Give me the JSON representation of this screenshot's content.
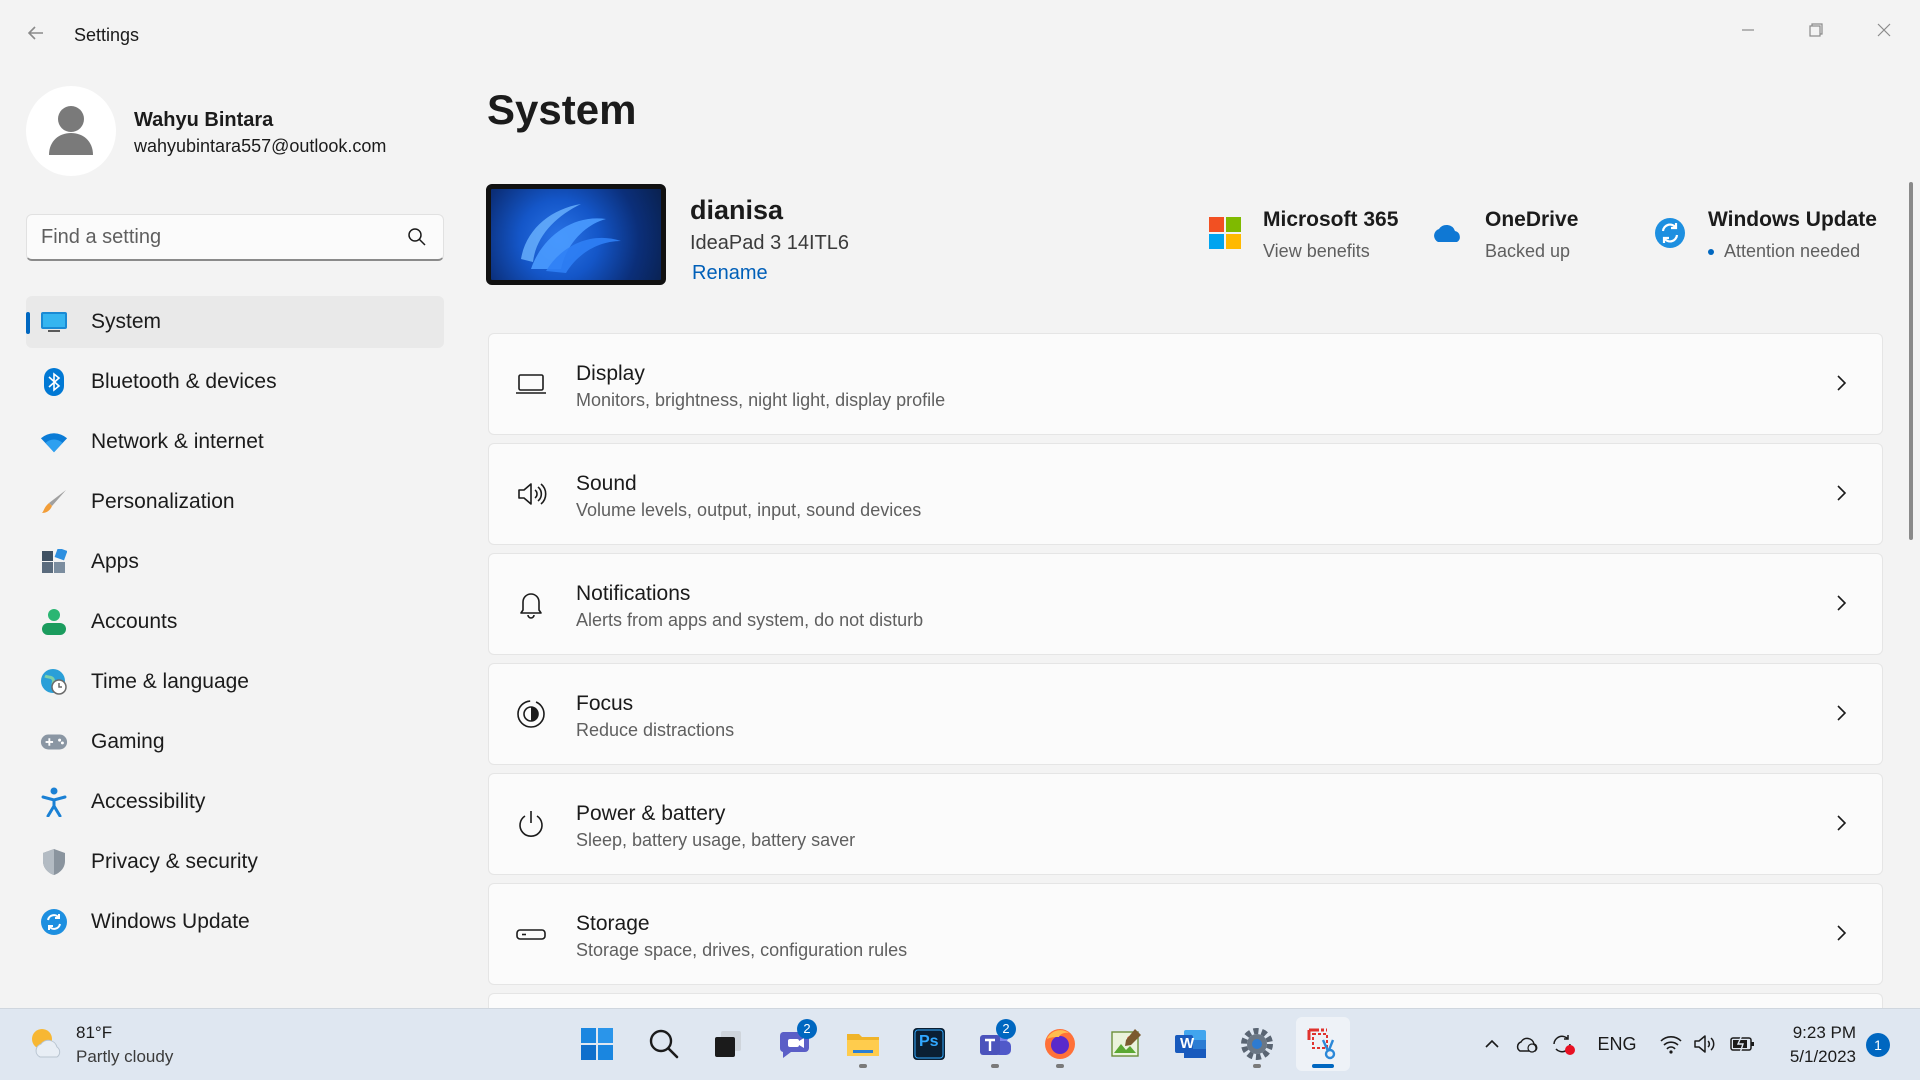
{
  "window": {
    "title": "Settings"
  },
  "profile": {
    "name": "Wahyu Bintara",
    "email": "wahyubintara557@outlook.com"
  },
  "search": {
    "placeholder": "Find a setting"
  },
  "nav": {
    "items": [
      {
        "label": "System",
        "icon": "system-icon",
        "active": true
      },
      {
        "label": "Bluetooth & devices",
        "icon": "bluetooth-icon"
      },
      {
        "label": "Network & internet",
        "icon": "wifi-icon"
      },
      {
        "label": "Personalization",
        "icon": "brush-icon"
      },
      {
        "label": "Apps",
        "icon": "apps-icon"
      },
      {
        "label": "Accounts",
        "icon": "accounts-icon"
      },
      {
        "label": "Time & language",
        "icon": "globe-clock-icon"
      },
      {
        "label": "Gaming",
        "icon": "gamepad-icon"
      },
      {
        "label": "Accessibility",
        "icon": "accessibility-icon"
      },
      {
        "label": "Privacy & security",
        "icon": "shield-icon"
      },
      {
        "label": "Windows Update",
        "icon": "update-icon"
      }
    ]
  },
  "main": {
    "title": "System",
    "device": {
      "name": "dianisa",
      "model": "IdeaPad 3 14ITL6",
      "rename_label": "Rename"
    },
    "tiles": [
      {
        "title": "Microsoft 365",
        "subtitle": "View benefits",
        "icon": "microsoft365-icon"
      },
      {
        "title": "OneDrive",
        "subtitle": "Backed up",
        "icon": "onedrive-icon"
      },
      {
        "title": "Windows Update",
        "subtitle": "Attention needed",
        "icon": "update-icon"
      }
    ],
    "cards": [
      {
        "title": "Display",
        "subtitle": "Monitors, brightness, night light, display profile",
        "icon": "display-icon"
      },
      {
        "title": "Sound",
        "subtitle": "Volume levels, output, input, sound devices",
        "icon": "speaker-icon"
      },
      {
        "title": "Notifications",
        "subtitle": "Alerts from apps and system, do not disturb",
        "icon": "bell-icon"
      },
      {
        "title": "Focus",
        "subtitle": "Reduce distractions",
        "icon": "focus-icon"
      },
      {
        "title": "Power & battery",
        "subtitle": "Sleep, battery usage, battery saver",
        "icon": "power-icon"
      },
      {
        "title": "Storage",
        "subtitle": "Storage space, drives, configuration rules",
        "icon": "storage-icon"
      }
    ]
  },
  "taskbar": {
    "weather": {
      "temp": "81°F",
      "desc": "Partly cloudy"
    },
    "apps": [
      {
        "name": "start",
        "icon": "windows-start-icon"
      },
      {
        "name": "search",
        "icon": "search-icon"
      },
      {
        "name": "task-view",
        "icon": "task-view-icon"
      },
      {
        "name": "chat",
        "icon": "chat-icon",
        "badge": "2"
      },
      {
        "name": "file-explorer",
        "icon": "folder-icon"
      },
      {
        "name": "photoshop",
        "icon": "photoshop-icon",
        "text": "Ps"
      },
      {
        "name": "teams",
        "icon": "teams-icon",
        "badge": "2"
      },
      {
        "name": "firefox",
        "icon": "firefox-icon"
      },
      {
        "name": "image-editor",
        "icon": "image-editor-icon"
      },
      {
        "name": "word",
        "icon": "word-icon",
        "text": "W"
      },
      {
        "name": "settings",
        "icon": "gear-icon"
      },
      {
        "name": "snipping-tool",
        "icon": "snipping-tool-icon"
      }
    ],
    "tray": {
      "language": "ENG"
    },
    "clock": {
      "time": "9:23 PM",
      "date": "5/1/2023"
    },
    "notifications": {
      "count": "1"
    }
  },
  "colors": {
    "accent": "#0067c0",
    "link": "#005fb8",
    "background": "#f3f3f3",
    "card": "#fbfbfb"
  }
}
